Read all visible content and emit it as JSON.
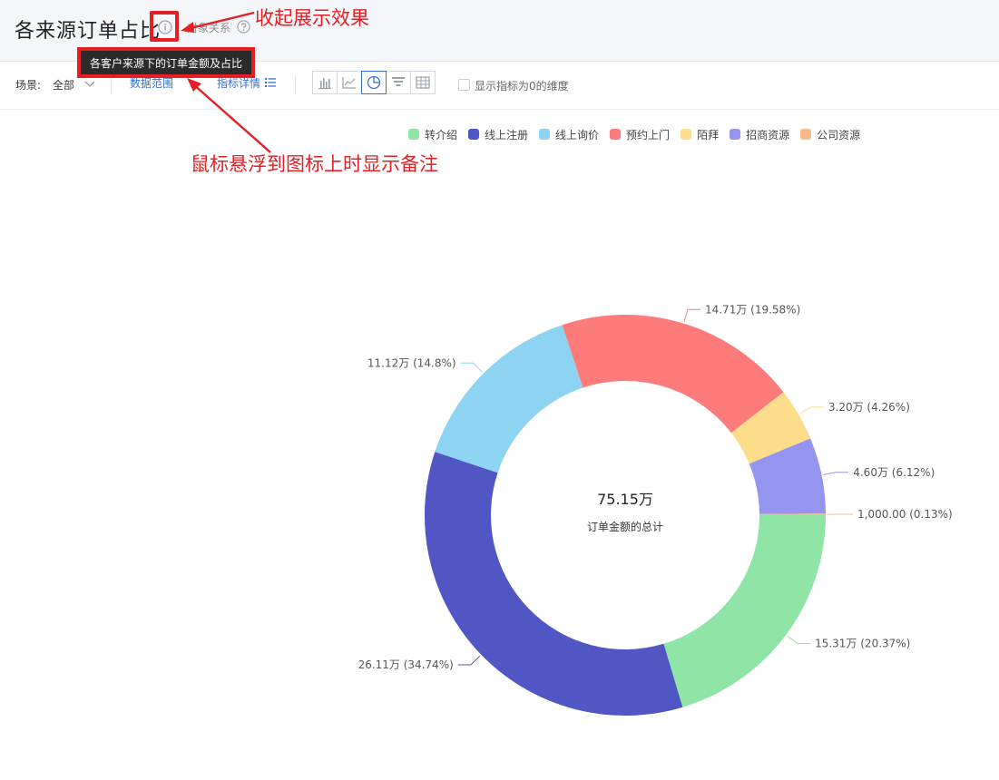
{
  "header": {
    "title": "各来源订单占比",
    "sub_link": "对象关系",
    "tooltip": "各客户来源下的订单金额及占比"
  },
  "annotations": {
    "collapse_note": "收起展示效果",
    "hover_note": "鼠标悬浮到图标上时显示备注"
  },
  "toolbar": {
    "scene_label": "场景:",
    "scene_value": "全部",
    "range_link": "数据范围",
    "detail_link": "指标详情",
    "show_zero_label": "显示指标为0的维度"
  },
  "colors": {
    "annotation": "#e51f23",
    "link": "#3a6fd8"
  },
  "chart_data": {
    "type": "pie",
    "donut": true,
    "center_value": "75.15万",
    "center_label": "订单金额的总计",
    "legend_position": "top",
    "slices": [
      {
        "name": "转介绍",
        "value": 153100,
        "label": "15.31万 (20.37%)",
        "color": "#8ee5a5"
      },
      {
        "name": "线上注册",
        "value": 261100,
        "label": "26.11万 (34.74%)",
        "color": "#5156c5"
      },
      {
        "name": "线上询价",
        "value": 111200,
        "label": "11.12万 (14.8%)",
        "color": "#8dd3f2"
      },
      {
        "name": "预约上门",
        "value": 147100,
        "label": "14.71万 (19.58%)",
        "color": "#fd7b7b"
      },
      {
        "name": "陌拜",
        "value": 32000,
        "label": "3.20万 (4.26%)",
        "color": "#fddc8b"
      },
      {
        "name": "招商资源",
        "value": 46000,
        "label": "4.60万 (6.12%)",
        "color": "#9595ef"
      },
      {
        "name": "公司资源",
        "value": 1000,
        "label": "1,000.00 (0.13%)",
        "color": "#fbb98a"
      }
    ]
  }
}
